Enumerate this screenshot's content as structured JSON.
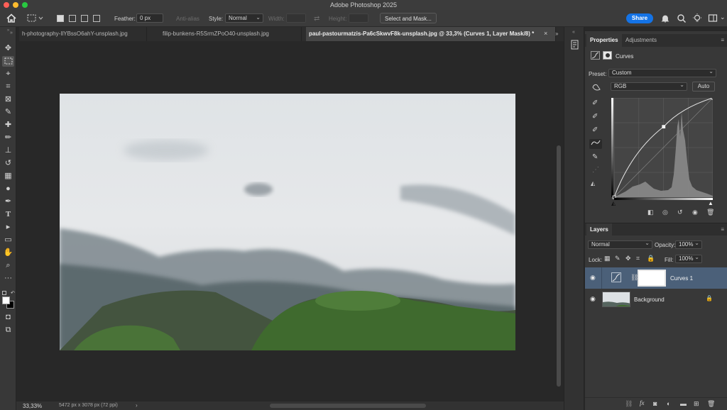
{
  "app": {
    "title": "Adobe Photoshop 2025"
  },
  "options_bar": {
    "feather_label": "Feather:",
    "feather_value": "0 px",
    "anti_alias_label": "Anti-alias",
    "style_label": "Style:",
    "style_value": "Normal",
    "width_label": "Width:",
    "height_label": "Height:",
    "select_mask_label": "Select and Mask...",
    "share_label": "Share"
  },
  "tabs": [
    {
      "label": "h-photography-IlYBssO6ahY-unsplash.jpg",
      "active": false
    },
    {
      "label": "filip-bunkens-R5SrmZPoO40-unsplash.jpg",
      "active": false
    },
    {
      "label": "paul-pastourmatzis-Pa6cSkwvF8k-unsplash.jpg @ 33,3% (Curves 1, Layer Mask/8) *",
      "active": true
    }
  ],
  "status": {
    "zoom": "33,33%",
    "doc_info": "5472 px x 3078 px (72 ppi)"
  },
  "properties": {
    "tab_properties": "Properties",
    "tab_adjustments": "Adjustments",
    "header_title": "Curves",
    "preset_label": "Preset:",
    "preset_value": "Custom",
    "channel_value": "RGB",
    "auto_label": "Auto"
  },
  "curve": {
    "input_range": [
      0,
      255
    ],
    "output_range": [
      0,
      255
    ],
    "points": [
      [
        0,
        0
      ],
      [
        128,
        181
      ],
      [
        255,
        255
      ]
    ]
  },
  "layers": {
    "tab_label": "Layers",
    "blend_mode": "Normal",
    "opacity_label": "Opacity:",
    "opacity_value": "100%",
    "lock_label": "Lock:",
    "fill_label": "Fill:",
    "fill_value": "100%",
    "items": [
      {
        "name": "Curves 1",
        "selected": true
      },
      {
        "name": "Background",
        "selected": false
      }
    ]
  },
  "colors": {
    "accent": "#1473e6",
    "selected_layer": "#4b6079",
    "panel_bg": "#383838",
    "canvas_bg": "#282828"
  }
}
